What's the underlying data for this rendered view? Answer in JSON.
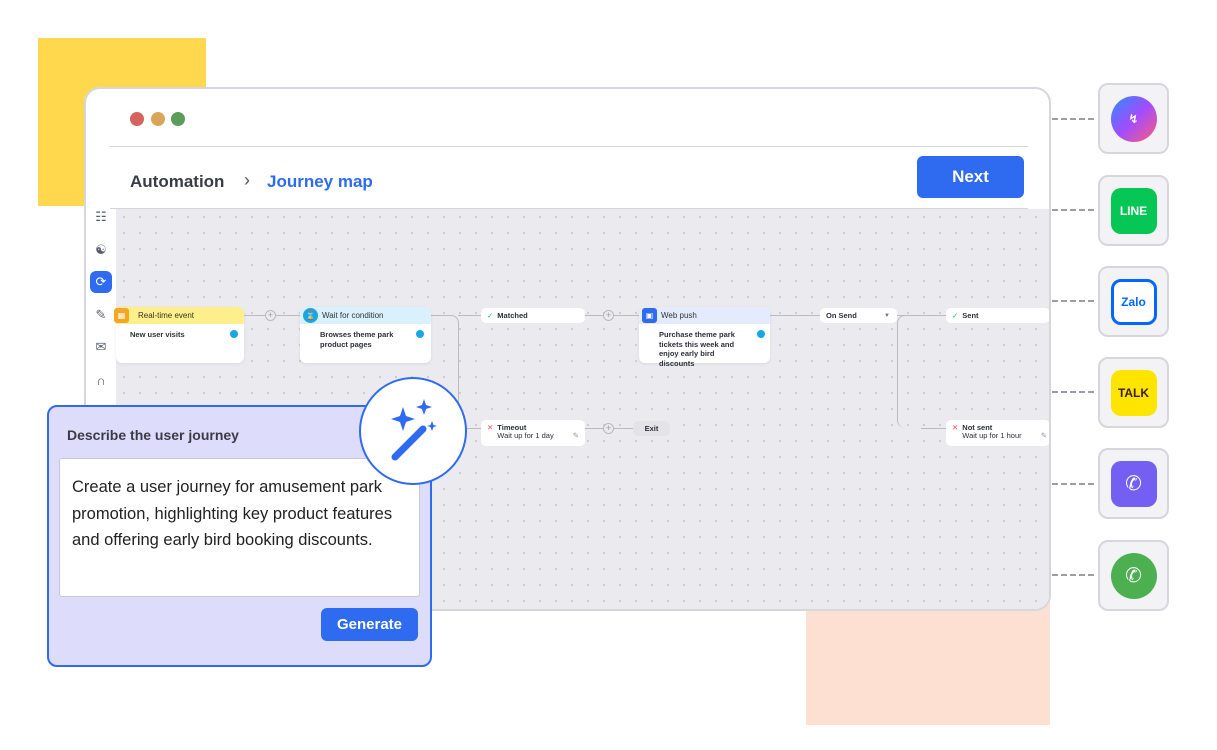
{
  "window": {
    "traffic_lights": [
      "#d5635e",
      "#d9a55b",
      "#5a9e5a"
    ]
  },
  "breadcrumb": {
    "parent": "Automation",
    "separator": ">",
    "current": "Journey map"
  },
  "header": {
    "next_label": "Next"
  },
  "sidebar": {
    "items": [
      {
        "icon": "flow-icon"
      },
      {
        "icon": "users-icon"
      },
      {
        "icon": "journey-icon",
        "active": true
      },
      {
        "icon": "edit-message-icon"
      },
      {
        "icon": "chat-icon"
      },
      {
        "icon": "magnet-icon"
      }
    ]
  },
  "journey": {
    "trigger": {
      "title": "Real-time event",
      "body": "New user visits",
      "color": "#fdf08a"
    },
    "condition": {
      "title": "Wait for condition",
      "body": "Browses theme park product pages",
      "color": "#d8f1fb"
    },
    "matched": {
      "label": "Matched"
    },
    "timeout": {
      "label": "Timeout",
      "sub": "Wait up for 1 day"
    },
    "exit": {
      "label": "Exit"
    },
    "webpush": {
      "title": "Web push",
      "body": "Purchase theme park tickets this week and enjoy early bird discounts",
      "color": "#e3ebfc"
    },
    "on_send": {
      "value": "On Send"
    },
    "sent": {
      "label": "Sent"
    },
    "not_sent": {
      "label": "Not sent",
      "sub": "Wait up for 1 hour"
    }
  },
  "prompt_panel": {
    "title": "Describe the user journey",
    "text": "Create a user journey for amusement park promotion, highlighting key product features and offering early bird booking discounts.",
    "generate_label": "Generate"
  },
  "channels": [
    {
      "name": "Messenger",
      "icon": "messenger-icon",
      "color": "#7b4dff"
    },
    {
      "name": "LINE",
      "label": "LINE",
      "icon": "line-icon",
      "color": "#06c755"
    },
    {
      "name": "Zalo",
      "label": "Zalo",
      "icon": "zalo-icon",
      "color": "#0068ff"
    },
    {
      "name": "KakaoTalk",
      "label": "TALK",
      "icon": "kakaotalk-icon",
      "color": "#fee500"
    },
    {
      "name": "Viber",
      "icon": "viber-icon",
      "color": "#7360f2"
    },
    {
      "name": "WhatsApp",
      "icon": "whatsapp-icon",
      "color": "#4caf50"
    }
  ]
}
